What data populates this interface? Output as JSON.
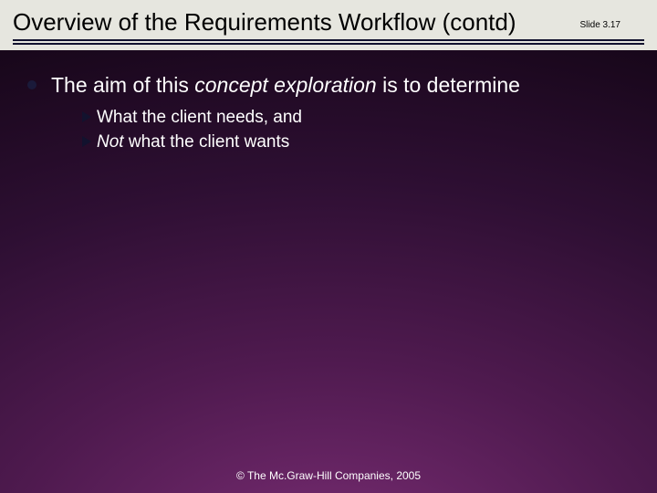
{
  "header": {
    "title": "Overview of the Requirements Workflow (contd)",
    "slide_number": "Slide 3.17"
  },
  "content": {
    "main_pre": "The aim of this ",
    "main_italic": "concept exploration",
    "main_post": " is to determine",
    "sub1": "What the client needs, and",
    "sub2_italic": "Not",
    "sub2_rest": " what the client wants"
  },
  "footer": {
    "copyright": "© The Mc.Graw-Hill Companies, 2005"
  }
}
